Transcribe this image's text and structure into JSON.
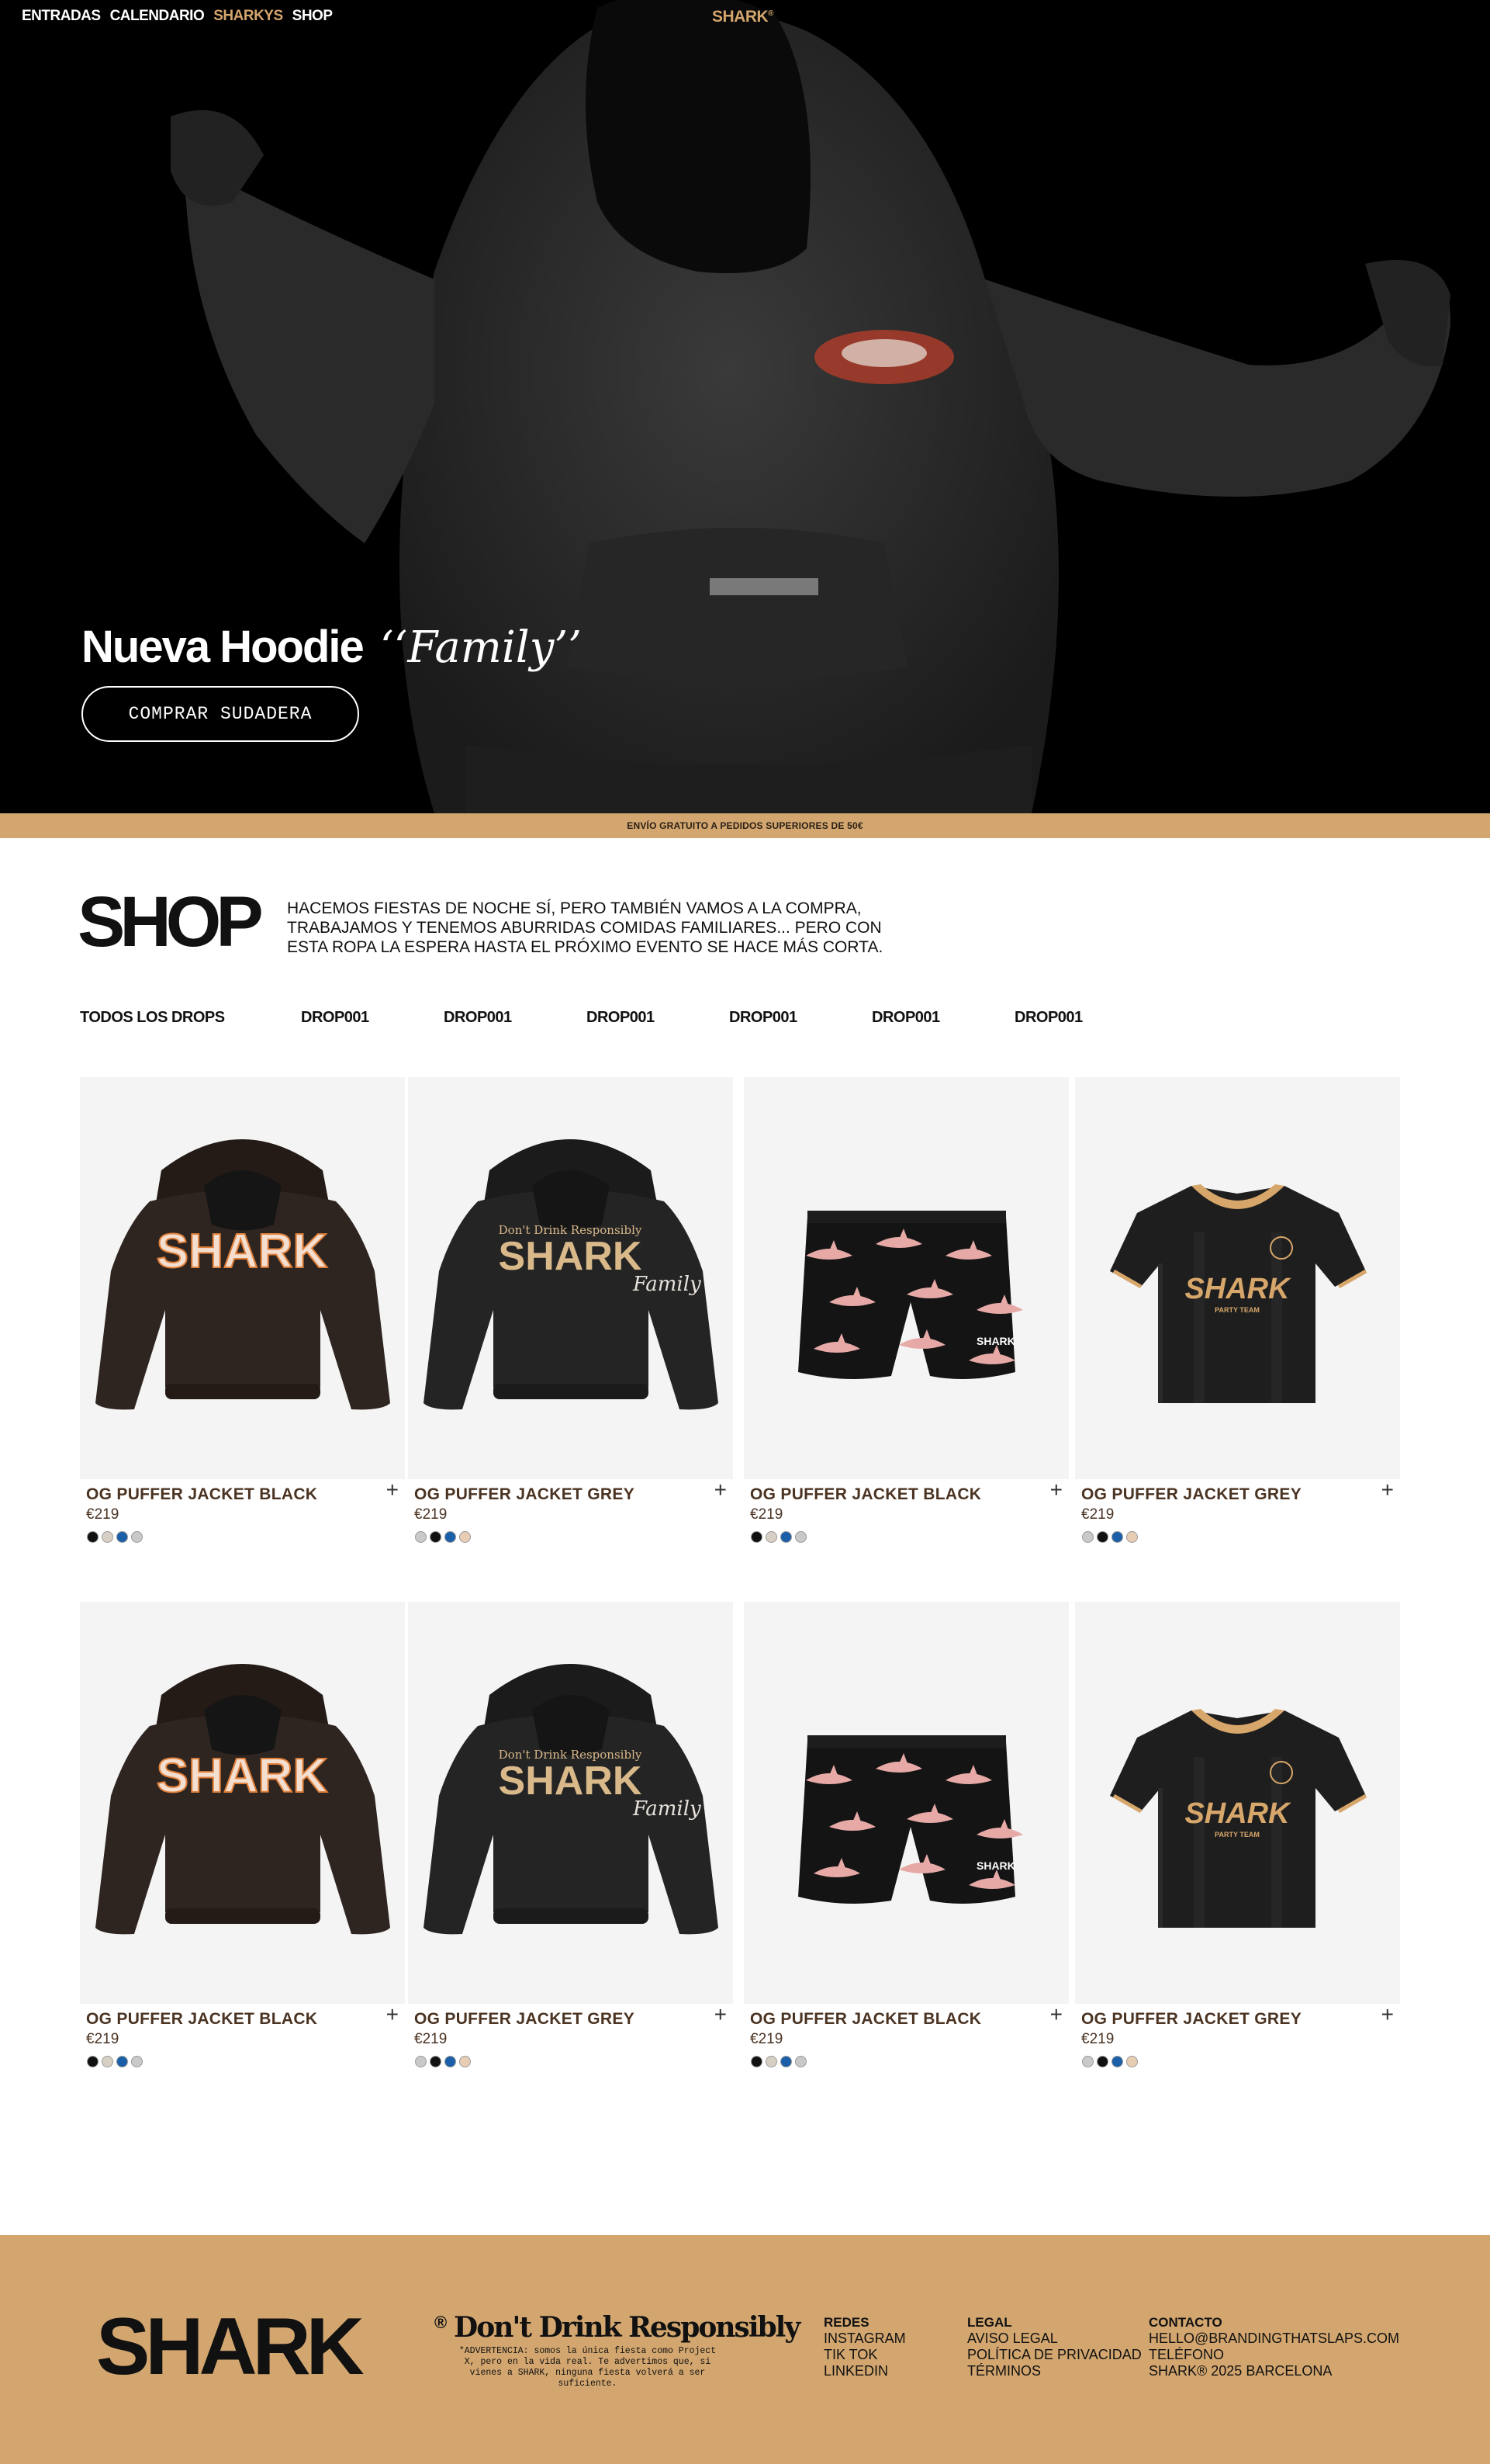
{
  "nav": {
    "items": [
      {
        "label": "ENTRADAS",
        "active": false
      },
      {
        "label": "CALENDARIO",
        "active": false
      },
      {
        "label": "SHARKYS",
        "active": true
      },
      {
        "label": "SHOP",
        "active": false
      }
    ],
    "logo": "SHARK",
    "logo_mark": "®"
  },
  "hero": {
    "title": "Nueva Hoodie",
    "title_script": "‘‘Family’’",
    "cta_label": "COMPRAR SUDADERA"
  },
  "shipping_banner": "ENVÍO GRATUITO A PEDIDOS SUPERIORES DE 50€",
  "shop": {
    "title": "SHOP",
    "description": "HACEMOS FIESTAS DE NOCHE SÍ, PERO TAMBIÉN VAMOS A LA COMPRA, TRABAJAMOS Y TENEMOS ABURRIDAS COMIDAS FAMILIARES... PERO CON ESTA ROPA LA ESPERA HASTA EL PRÓXIMO EVENTO SE HACE MÁS CORTA.",
    "filters": [
      "TODOS LOS DROPS",
      "DROP001",
      "DROP001",
      "DROP001",
      "DROP001",
      "DROP001",
      "DROP001"
    ]
  },
  "products": [
    {
      "name": "OG PUFFER JACKET BLACK",
      "price": "€219",
      "image": "hoodie-brown",
      "swatches": [
        "#111111",
        "#d8cfc4",
        "#1a5fa8",
        "#c9c9c9"
      ]
    },
    {
      "name": "OG PUFFER JACKET GREY",
      "price": "€219",
      "image": "hoodie-black",
      "swatches": [
        "#c9c9c9",
        "#111111",
        "#1a5fa8",
        "#e8cdb5"
      ]
    },
    {
      "name": "OG PUFFER JACKET BLACK",
      "price": "€219",
      "image": "shorts",
      "swatches": [
        "#111111",
        "#d8cfc4",
        "#1a5fa8",
        "#c9c9c9"
      ]
    },
    {
      "name": "OG PUFFER JACKET GREY",
      "price": "€219",
      "image": "jersey",
      "swatches": [
        "#c9c9c9",
        "#111111",
        "#1a5fa8",
        "#e8cdb5"
      ]
    },
    {
      "name": "OG PUFFER JACKET BLACK",
      "price": "€219",
      "image": "hoodie-brown",
      "swatches": [
        "#111111",
        "#d8cfc4",
        "#1a5fa8",
        "#c9c9c9"
      ]
    },
    {
      "name": "OG PUFFER JACKET GREY",
      "price": "€219",
      "image": "hoodie-black",
      "swatches": [
        "#c9c9c9",
        "#111111",
        "#1a5fa8",
        "#e8cdb5"
      ]
    },
    {
      "name": "OG PUFFER JACKET BLACK",
      "price": "€219",
      "image": "shorts",
      "swatches": [
        "#111111",
        "#d8cfc4",
        "#1a5fa8",
        "#c9c9c9"
      ]
    },
    {
      "name": "OG PUFFER JACKET GREY",
      "price": "€219",
      "image": "jersey",
      "swatches": [
        "#c9c9c9",
        "#111111",
        "#1a5fa8",
        "#e8cdb5"
      ]
    }
  ],
  "product_art": {
    "brand_word": "SHARK",
    "family_word": "Family",
    "slogan_small": "Don't Drink Responsibly",
    "jersey_sub": "PARTY TEAM"
  },
  "footer": {
    "logo": "SHARK",
    "reg": "®",
    "slogan": "Don't Drink Responsibly",
    "warning": "*ADVERTENCIA: somos la única fiesta como Project X, pero en la vida real. Te advertimos que, si vienes a SHARK, ninguna fiesta volverá a ser suficiente.",
    "redes": {
      "heading": "REDES",
      "links": [
        "INSTAGRAM",
        "TIK TOK",
        "LINKEDIN"
      ]
    },
    "legal": {
      "heading": "LEGAL",
      "links": [
        "AVISO LEGAL",
        "POLÍTICA DE PRIVACIDAD",
        "TÉRMINOS"
      ]
    },
    "contacto": {
      "heading": "CONTACTO",
      "lines": [
        "HELLO@BRANDINGTHATSLAPS.COM",
        "TELÉFONO",
        "SHARK® 2025 BARCELONA"
      ]
    }
  },
  "colors": {
    "accent": "#d3a66f",
    "text_brown": "#4b3322",
    "card_bg": "#f4f4f4",
    "hero_bg": "#000000"
  }
}
